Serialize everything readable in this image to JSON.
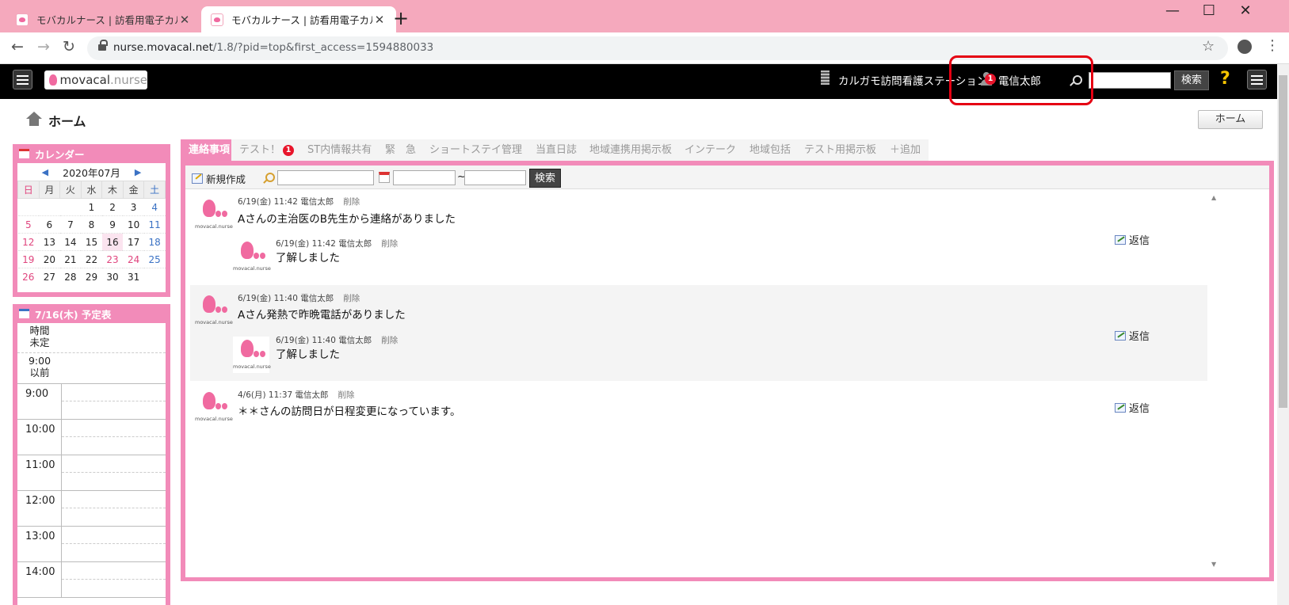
{
  "browser": {
    "tabs": [
      {
        "title": "モバカルナース | 訪看用電子カルテ",
        "active": false
      },
      {
        "title": "モバカルナース | 訪看用電子カルテ",
        "active": true
      }
    ],
    "url_host": "nurse.movacal.net",
    "url_path": "/1.8/?pid=top&first_access=1594880033"
  },
  "header": {
    "logo_main": "movacal",
    "logo_sub": ".nurse",
    "station": "カルガモ訪問看護ステーション",
    "user_badge": "1",
    "user_name": "電信太郎",
    "search_button": "検索",
    "help": "?"
  },
  "page": {
    "title": "ホーム",
    "home_button": "ホーム"
  },
  "calendar": {
    "title": "カレンダー",
    "month": "2020年07月",
    "dow": [
      "日",
      "月",
      "火",
      "水",
      "木",
      "金",
      "土"
    ],
    "weeks": [
      [
        "",
        "",
        "",
        "1",
        "2",
        "3",
        "4"
      ],
      [
        "5",
        "6",
        "7",
        "8",
        "9",
        "10",
        "11"
      ],
      [
        "12",
        "13",
        "14",
        "15",
        "16",
        "17",
        "18"
      ],
      [
        "19",
        "20",
        "21",
        "22",
        "23",
        "24",
        "25"
      ],
      [
        "26",
        "27",
        "28",
        "29",
        "30",
        "31",
        ""
      ]
    ],
    "today": "16",
    "holidays": [
      "23",
      "24"
    ]
  },
  "schedule": {
    "title": "7/16(木) 予定表",
    "undetermined_1": "時間",
    "undetermined_2": "未定",
    "before_1": "9:00",
    "before_2": "以前",
    "hours": [
      "9:00",
      "10:00",
      "11:00",
      "12:00",
      "13:00",
      "14:00"
    ]
  },
  "board": {
    "tabs": [
      {
        "label": "連絡事項",
        "badge": ""
      },
      {
        "label": "テスト！",
        "badge": "1"
      },
      {
        "label": "ST内情報共有",
        "badge": ""
      },
      {
        "label": "緊　急",
        "badge": ""
      },
      {
        "label": "ショートステイ管理",
        "badge": ""
      },
      {
        "label": "当直日誌",
        "badge": ""
      },
      {
        "label": "地域連携用掲示板",
        "badge": ""
      },
      {
        "label": "インテーク",
        "badge": ""
      },
      {
        "label": "地域包括",
        "badge": ""
      },
      {
        "label": "テスト用掲示板",
        "badge": ""
      },
      {
        "label": "＋追加",
        "badge": ""
      }
    ],
    "toolbar": {
      "new_label": "新規作成",
      "tilde": "~",
      "search_label": "検索"
    },
    "delete_label": "削除",
    "reply_label": "返信",
    "avatar_caption": "movacal.nurse",
    "posts": [
      {
        "meta": "6/19(金) 11:42 電信太郎",
        "text": "Aさんの主治医のB先生から連絡がありました",
        "reply_meta": "6/19(金) 11:42 電信太郎",
        "reply_text": "了解しました"
      },
      {
        "meta": "6/19(金) 11:40 電信太郎",
        "text": "Aさん発熱で昨晩電話がありました",
        "reply_meta": "6/19(金) 11:40 電信太郎",
        "reply_text": "了解しました"
      },
      {
        "meta": "4/6(月) 11:37 電信太郎",
        "text": "＊＊さんの訪問日が日程変更になっています。"
      }
    ]
  }
}
